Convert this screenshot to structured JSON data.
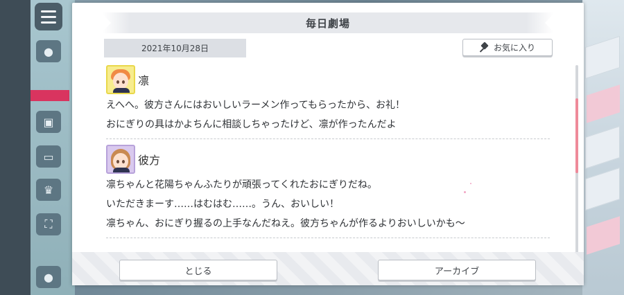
{
  "dialog": {
    "title": "毎日劇場",
    "date": "2021年10月28日",
    "favorite_label": "お気に入り",
    "close_label": "とじる",
    "archive_label": "アーカイブ"
  },
  "entries": [
    {
      "speaker": "凛",
      "lines": [
        "えへへ。彼方さんにはおいしいラーメン作ってもらったから、お礼！",
        "おにぎりの具はかよちんに相談しちゃったけど、凛が作ったんだよ"
      ]
    },
    {
      "speaker": "彼方",
      "lines": [
        "凛ちゃんと花陽ちゃんふたりが頑張ってくれたおにぎりだね。",
        "いただきまーす……はむはむ……。うん、おいしい！",
        "凛ちゃん、おにぎり握るの上手なんだねえ。彼方ちゃんが作るよりおいしいかも～"
      ]
    }
  ],
  "colors": {
    "scroll_thumb": "#ef8a9a",
    "rin_avatar_bg": "#f7ec8e",
    "kanata_avatar_bg": "#d9c9ee"
  },
  "icons": {
    "favorite": "pin-icon",
    "menu": "hamburger-icon"
  }
}
